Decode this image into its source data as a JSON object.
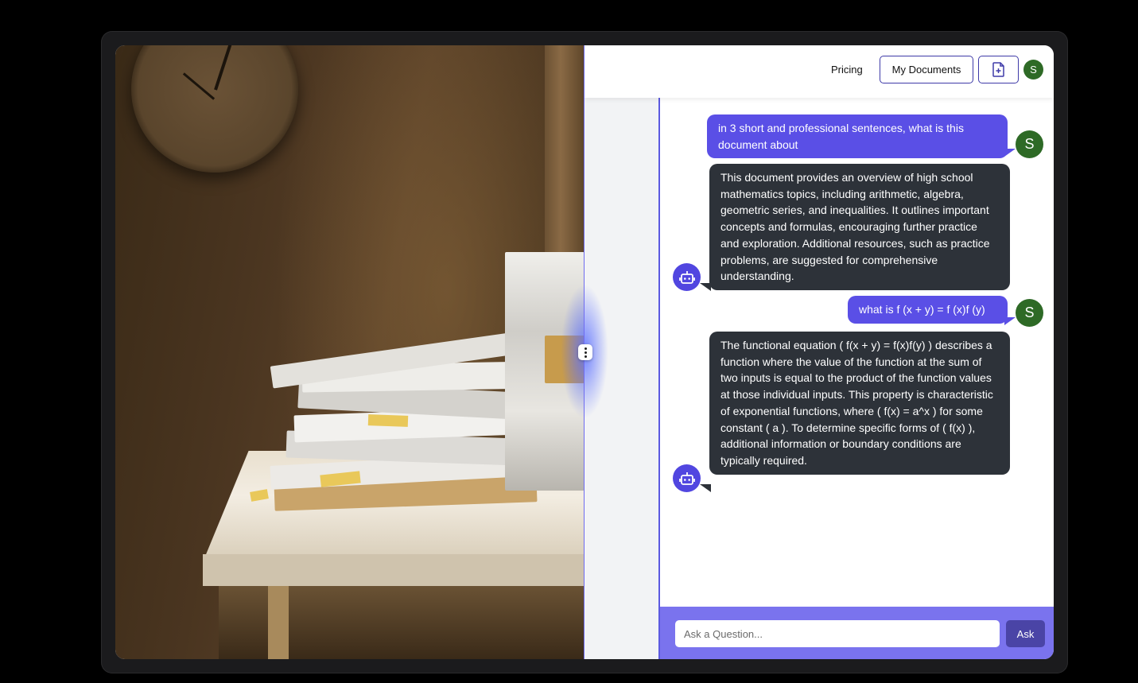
{
  "header": {
    "pricing_label": "Pricing",
    "my_documents_label": "My Documents",
    "user_initial": "S"
  },
  "messages": [
    {
      "role": "user",
      "avatar": "S",
      "text": "in 3 short and professional sentences, what is this document about"
    },
    {
      "role": "bot",
      "avatar_icon": "robot-icon",
      "text": "This document provides an overview of high school mathematics topics, including arithmetic, algebra, geometric series, and inequalities. It outlines important concepts and formulas, encouraging further practice and exploration. Additional resources, such as practice problems, are suggested for comprehensive understanding."
    },
    {
      "role": "user",
      "avatar": "S",
      "text": "what is f (x + y) = f (x)f (y)"
    },
    {
      "role": "bot",
      "avatar_icon": "robot-icon",
      "text": "The functional equation ( f(x + y) = f(x)f(y) ) describes a function where the value of the function at the sum of two inputs is equal to the product of the function values at those individual inputs. This property is characteristic of exponential functions, where ( f(x) = a^x ) for some constant ( a ). To determine specific forms of ( f(x) ), additional information or boundary conditions are typically required."
    }
  ],
  "composer": {
    "placeholder": "Ask a Question...",
    "value": "",
    "ask_label": "Ask"
  },
  "colors": {
    "accent": "#5a4fe6",
    "bot_bubble": "#2d3239",
    "avatar_green": "#2e6a26",
    "input_bar": "#7a73ee"
  }
}
